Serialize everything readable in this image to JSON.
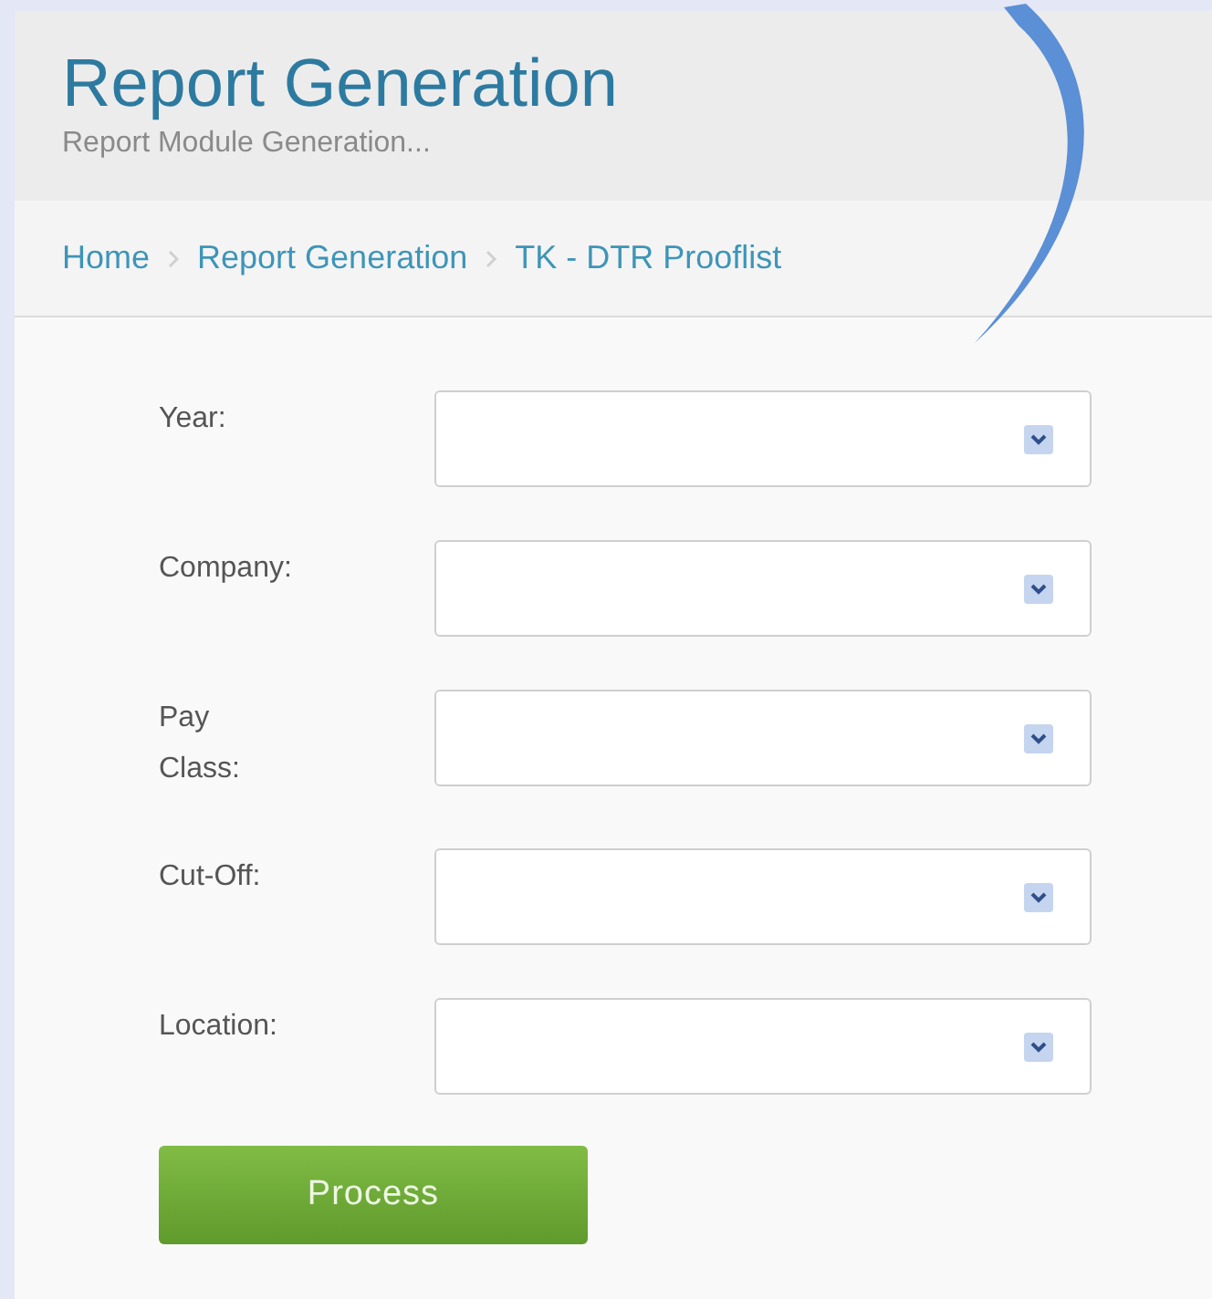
{
  "header": {
    "title": "Report Generation",
    "subtitle": "Report Module Generation..."
  },
  "breadcrumb": [
    {
      "label": "Home"
    },
    {
      "label": "Report Generation"
    },
    {
      "label": "TK - DTR Prooflist"
    }
  ],
  "form": {
    "fields": [
      {
        "label": "Year:"
      },
      {
        "label": "Company:"
      },
      {
        "label": "Pay Class:"
      },
      {
        "label": "Cut-Off:"
      },
      {
        "label": "Location:"
      }
    ],
    "submit": "Process"
  }
}
